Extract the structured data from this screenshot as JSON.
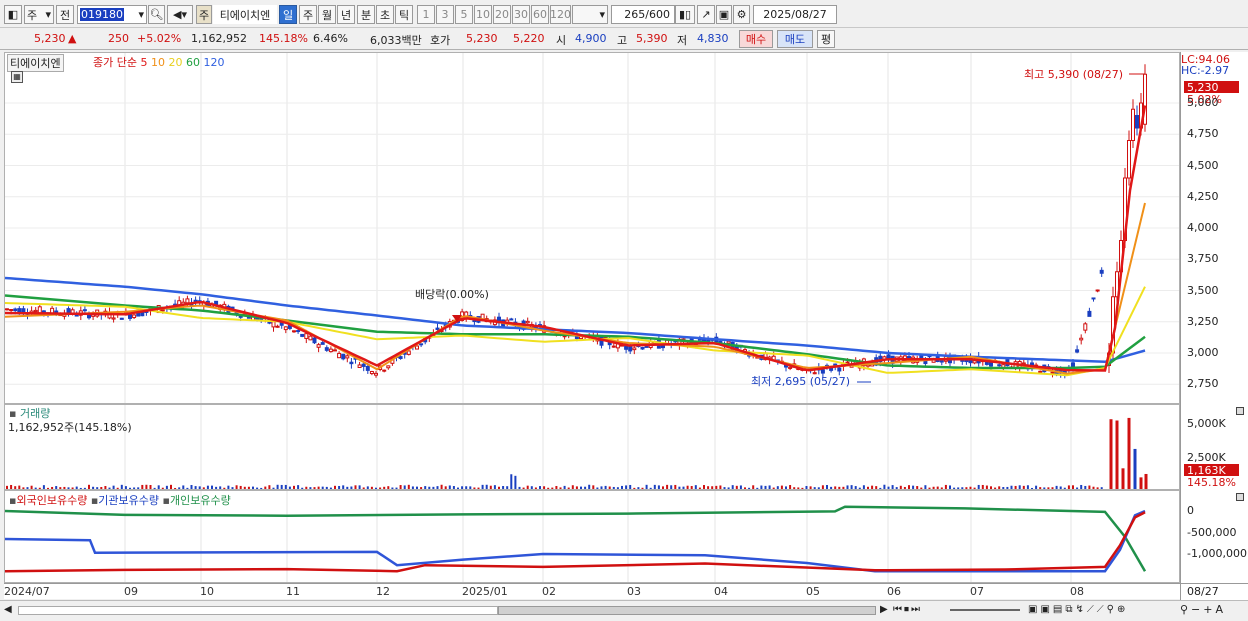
{
  "toolbar": {
    "market": "주",
    "prev": "전",
    "code": "019180",
    "stock_name": "티에이치엔",
    "stock_prefix": "주",
    "periods": [
      "일",
      "주",
      "월",
      "년",
      "분",
      "초",
      "틱"
    ],
    "active_period": "일",
    "intervals": [
      "1",
      "3",
      "5",
      "10",
      "20",
      "30",
      "60",
      "120"
    ],
    "count": "265",
    "count_total": "/600",
    "date": "2025/08/27"
  },
  "quote": {
    "price": "5,230",
    "change_arrow": "▲",
    "change": "250",
    "change_rate": "+5.02%",
    "volume": "1,162,952",
    "volume_rate": "145.18%",
    "turnover": "6.46%",
    "amount": "6,033백만",
    "bid_label": "호가",
    "ask_price": "5,230",
    "bid_price": "5,220",
    "open_label": "시",
    "open": "4,900",
    "high_label": "고",
    "high": "5,390",
    "low_label": "저",
    "low": "4,830",
    "buy_label": "매수",
    "sell_label": "매도",
    "eval_label": "평"
  },
  "price_chart": {
    "stock_tag": "티에이치엔",
    "legend_label": "종가 단순",
    "ma_periods": [
      "5",
      "10",
      "20",
      "60",
      "120"
    ],
    "lc": "LC:94.06",
    "hc": "HC:-2.97",
    "price_tag": "5,230",
    "rate_tag": "5.02%",
    "y_ticks": [
      "5,000",
      "4,750",
      "4,500",
      "4,250",
      "4,000",
      "3,750",
      "3,500",
      "3,250",
      "3,000",
      "2,750"
    ],
    "annotation_high": "최고 5,390 (08/27)",
    "annotation_low": "최저 2,695 (05/27)",
    "annotation_dividend": "배당락(0.00%)"
  },
  "volume_chart": {
    "title": "거래량",
    "value": "1,162,952주(145.18%)",
    "y_ticks": [
      "5,000K",
      "2,500K"
    ],
    "tag": "1,163K",
    "tag2": "145.18%"
  },
  "investor_chart": {
    "legend": [
      "외국인보유수량",
      "기관보유수량",
      "개인보유수량"
    ],
    "y_ticks": [
      "0",
      "-500,000",
      "-1,000,000"
    ]
  },
  "x_axis": [
    "2024/07",
    "09",
    "10",
    "11",
    "12",
    "2025/01",
    "02",
    "03",
    "04",
    "05",
    "06",
    "07",
    "08",
    "08/27"
  ],
  "colors": {
    "up": "#d01010",
    "down": "#1a3fc0",
    "ma5": "#e01818",
    "ma10": "#f09018",
    "ma20": "#f0e020",
    "ma60": "#20a040",
    "ma120": "#3060e0"
  },
  "chart_data": {
    "type": "line",
    "x": [
      "2024/07",
      "09",
      "10",
      "11",
      "12",
      "2025/01",
      "02",
      "03",
      "04",
      "05",
      "06",
      "07",
      "08",
      "08/27"
    ],
    "series": [
      {
        "name": "종가",
        "values": [
          3350,
          3300,
          3420,
          3200,
          2850,
          3300,
          3200,
          3050,
          3100,
          2850,
          2950,
          2950,
          2850,
          5230
        ]
      },
      {
        "name": "120",
        "values": [
          3600,
          3530,
          3470,
          3380,
          3300,
          3220,
          3190,
          3160,
          3110,
          3060,
          3000,
          2970,
          2940,
          3010
        ]
      },
      {
        "name": "60",
        "values": [
          3460,
          3380,
          3340,
          3260,
          3170,
          3150,
          3150,
          3130,
          3080,
          2990,
          2900,
          2880,
          2880,
          3130
        ]
      },
      {
        "name": "5",
        "values": [
          3320,
          3310,
          3410,
          3240,
          2900,
          3280,
          3210,
          3060,
          3080,
          2860,
          2950,
          2950,
          2860,
          4980
        ]
      }
    ],
    "ylim": [
      2600,
      5400
    ]
  }
}
